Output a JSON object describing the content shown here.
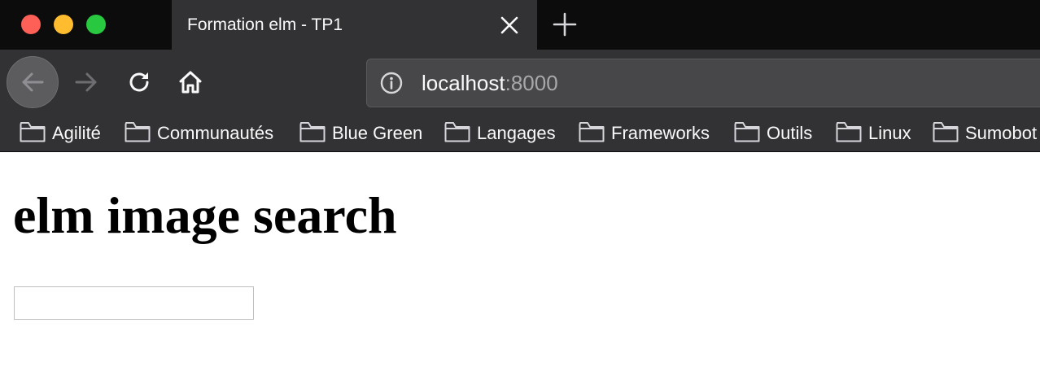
{
  "browser": {
    "tab": {
      "title": "Formation elm - TP1",
      "close_icon": "close-icon"
    },
    "new_tab_icon": "plus-icon",
    "nav": {
      "back_icon": "arrow-left-icon",
      "forward_icon": "arrow-right-icon",
      "reload_icon": "reload-icon",
      "home_icon": "home-icon"
    },
    "url": {
      "info_icon": "info-icon",
      "host": "localhost",
      "port": ":8000"
    },
    "bookmarks": [
      {
        "label": "Agilité",
        "icon": "folder-icon"
      },
      {
        "label": "Communautés",
        "icon": "folder-icon"
      },
      {
        "label": "Blue Green",
        "icon": "folder-icon"
      },
      {
        "label": "Langages",
        "icon": "folder-icon"
      },
      {
        "label": "Frameworks",
        "icon": "folder-icon"
      },
      {
        "label": "Outils",
        "icon": "folder-icon"
      },
      {
        "label": "Linux",
        "icon": "folder-icon"
      },
      {
        "label": "Sumobot",
        "icon": "folder-icon"
      }
    ]
  },
  "page": {
    "title": "elm image search",
    "search_value": "",
    "search_placeholder": ""
  },
  "colors": {
    "chrome_dark": "#0c0c0d",
    "toolbar": "#323234",
    "traffic_close": "#fe5f57",
    "traffic_minimize": "#febc2e",
    "traffic_maximize": "#28c840"
  }
}
